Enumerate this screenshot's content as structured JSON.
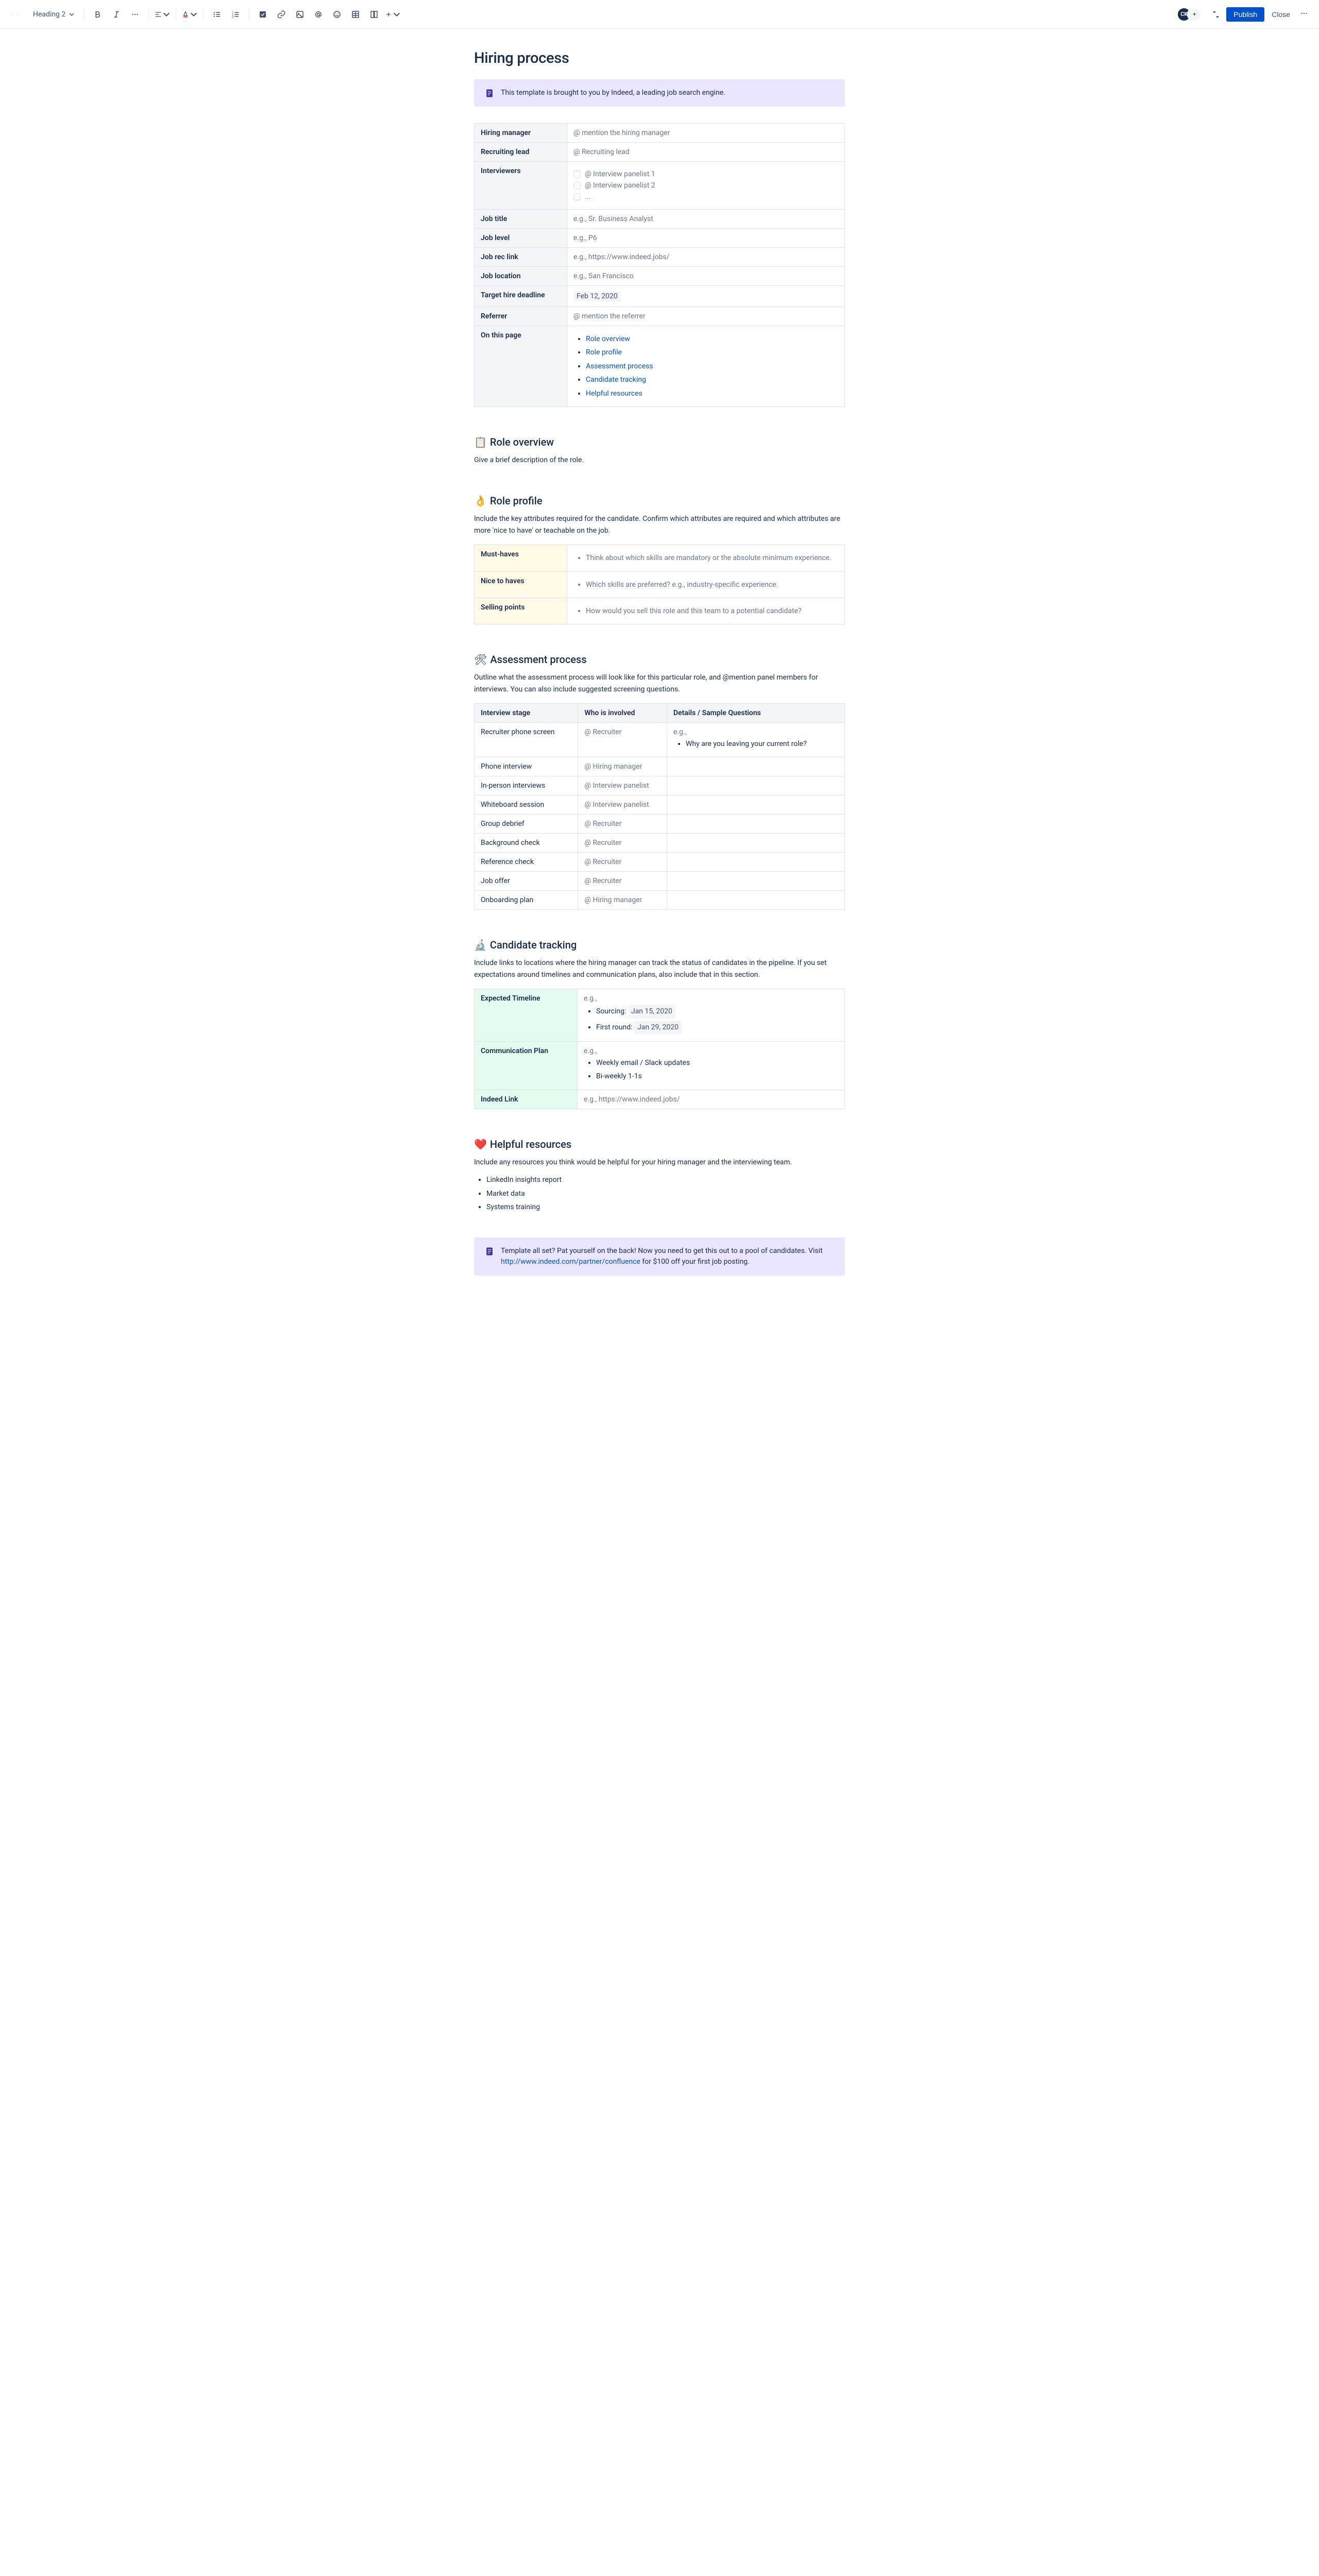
{
  "toolbar": {
    "style": "Heading 2",
    "publish": "Publish",
    "close": "Close",
    "avatar": "CK"
  },
  "title": "Hiring process",
  "banner1": "This template is brought to you by Indeed, a leading job search engine.",
  "meta": {
    "rows": [
      {
        "label": "Hiring manager",
        "value": "@ mention the hiring manager",
        "type": "mention"
      },
      {
        "label": "Recruiting lead",
        "value": "@ Recruiting lead",
        "type": "mention"
      }
    ],
    "interviewers_label": "Interviewers",
    "interviewers": [
      "@ Interview panelist 1",
      "@ Interview panelist 2",
      "..."
    ],
    "rows2": [
      {
        "label": "Job title",
        "value": "e.g., Sr. Business Analyst",
        "type": "placeholder"
      },
      {
        "label": "Job level",
        "value": "e.g., P6",
        "type": "placeholder"
      },
      {
        "label": "Job rec link",
        "value": "e.g., https://www.indeed.jobs/",
        "type": "placeholder"
      },
      {
        "label": "Job location",
        "value": "e.g., San Francisco",
        "type": "placeholder"
      }
    ],
    "deadline_label": "Target hire deadline",
    "deadline_value": "Feb 12, 2020",
    "referrer_label": "Referrer",
    "referrer_value": "@ mention the referrer",
    "onthispage_label": "On this page",
    "toc": [
      "Role overview",
      "Role profile",
      "Assessment process",
      "Candidate tracking",
      "Helpful resources"
    ]
  },
  "role_overview": {
    "heading": "Role overview",
    "emoji": "📋",
    "body": "Give a brief description of the role."
  },
  "role_profile": {
    "heading": "Role profile",
    "emoji": "👌",
    "body": "Include the key attributes required for the candidate. Confirm which attributes are required and which attributes are more 'nice to have' or teachable on the job.",
    "rows": [
      {
        "label": "Must-haves",
        "text": "Think about which skills are mandatory or the absolute minimum experience."
      },
      {
        "label": "Nice to haves",
        "text": "Which skills are preferred? e.g., industry-specific experience."
      },
      {
        "label": "Selling points",
        "text": "How would you sell this role and this team to a potential candidate?"
      }
    ]
  },
  "assessment": {
    "heading": "Assessment process",
    "emoji": "🛠",
    "body": "Outline what the assessment process will look like for this particular role, and @mention panel members for interviews. You can also include suggested screening questions.",
    "headers": [
      "Interview stage",
      "Who is involved",
      "Details / Sample Questions"
    ],
    "row1": {
      "stage": "Recruiter phone screen",
      "who": "@ Recruiter",
      "eg": "e.g.,",
      "q": "Why are you leaving your current role?"
    },
    "rows": [
      {
        "stage": "Phone interview",
        "who": "@ Hiring manager"
      },
      {
        "stage": "In-person interviews",
        "who": "@ Interview panelist"
      },
      {
        "stage": "Whiteboard session",
        "who": "@ Interview panelist"
      },
      {
        "stage": "Group debrief",
        "who": "@ Recruiter"
      },
      {
        "stage": "Background check",
        "who": "@ Recruiter"
      },
      {
        "stage": "Reference check",
        "who": "@ Recruiter"
      },
      {
        "stage": "Job offer",
        "who": "@ Recruiter"
      },
      {
        "stage": "Onboarding plan",
        "who": "@ Hiring manager"
      }
    ]
  },
  "tracking": {
    "heading": "Candidate tracking",
    "emoji": "🔬",
    "body": "Include links to locations where the hiring manager can track the status of candidates in the pipeline. If you set expectations around timelines and communication plans, also include that in this section.",
    "timeline_label": "Expected Timeline",
    "eg": "e.g.,",
    "timeline_items_pre": [
      "Sourcing:",
      "First round:"
    ],
    "timeline_dates": [
      "Jan 15, 2020",
      "Jan 29, 2020"
    ],
    "comm_label": "Communication Plan",
    "comm_items": [
      "Weekly email / Slack updates",
      "Bi-weekly 1-1s"
    ],
    "indeed_label": "Indeed Link",
    "indeed_value": "e.g., https://www.indeed.jobs/"
  },
  "resources": {
    "heading": "Helpful resources",
    "emoji": "❤️",
    "body": "Include any resources you think would be helpful for your hiring manager and the interviewing team.",
    "items": [
      "LinkedIn insights report",
      "Market data",
      "Systems training"
    ]
  },
  "banner2": {
    "pre": "Template all set? Pat yourself on the back! Now you need to get this out to a pool of candidates. Visit ",
    "link": "http://www.indeed.com/partner/confluence",
    "post": " for $100 off your first job posting."
  }
}
